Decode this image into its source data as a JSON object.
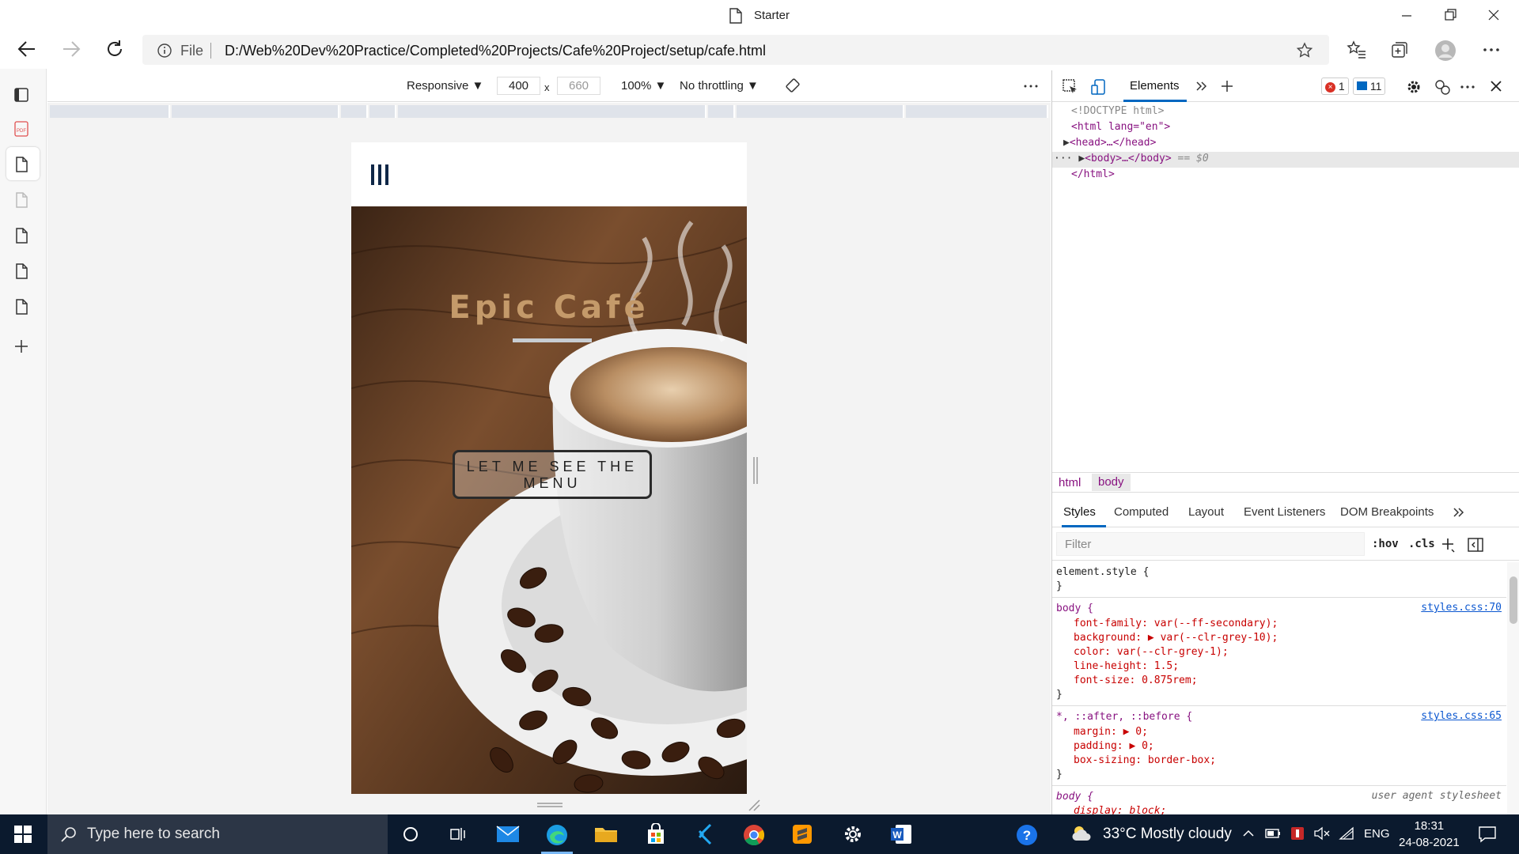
{
  "window": {
    "title": "Starter"
  },
  "address": {
    "file_label": "File",
    "url": "D:/Web%20Dev%20Practice/Completed%20Projects/Cafe%20Project/setup/cafe.html"
  },
  "device_toolbar": {
    "mode": "Responsive ▼",
    "width": "400",
    "height": "660",
    "zoom": "100% ▼",
    "throttling": "No throttling ▼"
  },
  "page": {
    "heading": "Epic Café",
    "cta_label": "LET ME SEE THE MENU"
  },
  "devtools": {
    "tab": "Elements",
    "errors": "1",
    "messages": "11",
    "dom": [
      {
        "t": "<!DOCTYPE html>"
      },
      {
        "t": "<html lang=\"en\">"
      },
      {
        "t": "<head>…</head>"
      },
      {
        "t": "<body>…</body>",
        "suffix": "== $0"
      },
      {
        "t": "</html>"
      }
    ],
    "breadcrumbs": [
      "html",
      "body"
    ],
    "panel_tabs": [
      "Styles",
      "Computed",
      "Layout",
      "Event Listeners",
      "DOM Breakpoints"
    ],
    "filter_placeholder": "Filter",
    "hov": ":hov",
    "cls": ".cls",
    "rules": {
      "element_style": "element.style {",
      "close": "}",
      "body_selector": "body {",
      "body_source": "styles.css:70",
      "body_props": [
        "font-family: var(--ff-secondary);",
        "background: ▶ var(--clr-grey-10);",
        "color: var(--clr-grey-1);",
        "line-height: 1.5;",
        "font-size: 0.875rem;"
      ],
      "star_selector": "*, ::after, ::before {",
      "star_source": "styles.css:65",
      "star_props": [
        "margin: ▶ 0;",
        "padding: ▶ 0;",
        "box-sizing: border-box;"
      ],
      "ua_selector": "body {",
      "ua_label": "user agent stylesheet",
      "ua_prop": "display: block;"
    }
  },
  "taskbar": {
    "search_placeholder": "Type here to search",
    "weather": "33°C  Mostly cloudy",
    "lang": "ENG",
    "time": "18:31",
    "date": "24-08-2021"
  },
  "colors": {
    "accent": "#0067c0",
    "heading": "#c49a6a",
    "taskbar": "#0b1a2e"
  }
}
